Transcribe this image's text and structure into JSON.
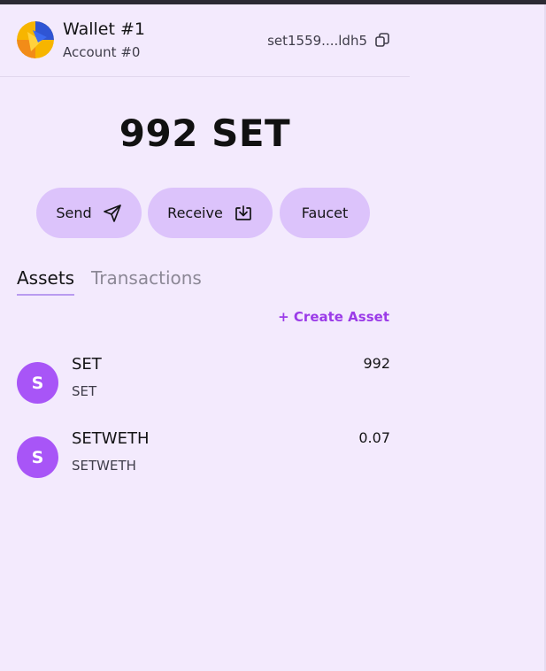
{
  "wallet": {
    "name": "Wallet #1",
    "account": "Account #0",
    "address": "set1559....ldh5"
  },
  "balance": "992 SET",
  "actions": {
    "send": "Send",
    "receive": "Receive",
    "faucet": "Faucet"
  },
  "tabs": {
    "assets": "Assets",
    "transactions": "Transactions",
    "active": "Assets"
  },
  "create_asset": "+ Create Asset",
  "assets": [
    {
      "icon_letter": "S",
      "name": "SET",
      "symbol": "SET",
      "amount": "992"
    },
    {
      "icon_letter": "S",
      "name": "SETWETH",
      "symbol": "SETWETH",
      "amount": "0.07"
    }
  ],
  "icons": {
    "avatar": "wallet-avatar-icon",
    "copy": "copy-icon",
    "send": "send-icon",
    "receive": "download-icon"
  },
  "colors": {
    "background": "#f3eafd",
    "button": "#dcc3fb",
    "accent": "#9b3be8",
    "asset_icon": "#a855f7"
  }
}
